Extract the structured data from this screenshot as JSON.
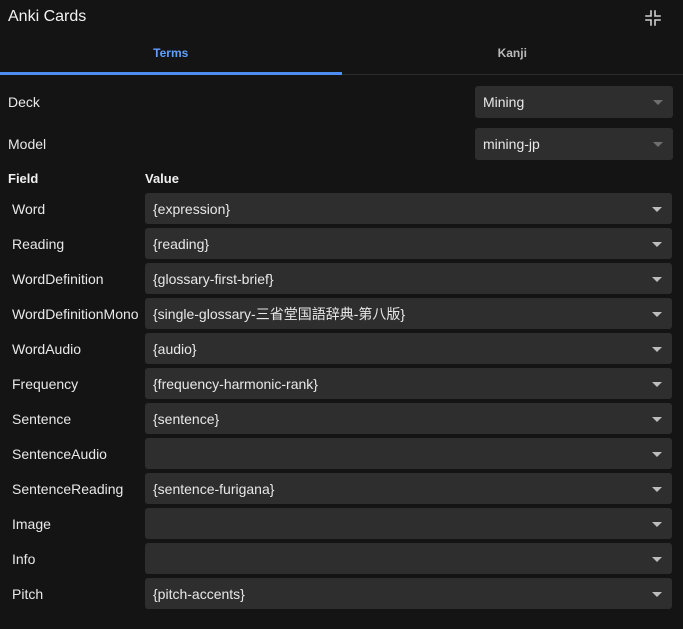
{
  "window": {
    "title": "Anki Cards",
    "collapse_icon": "collapse-arrows-icon"
  },
  "tabs": [
    {
      "label": "Terms",
      "active": true
    },
    {
      "label": "Kanji",
      "active": false
    }
  ],
  "deck": {
    "label": "Deck",
    "value": "Mining"
  },
  "model": {
    "label": "Model",
    "value": "mining-jp"
  },
  "fields_header": {
    "field": "Field",
    "value": "Value"
  },
  "fields": [
    {
      "name": "Word",
      "value": "{expression}"
    },
    {
      "name": "Reading",
      "value": "{reading}"
    },
    {
      "name": "WordDefinition",
      "value": "{glossary-first-brief}"
    },
    {
      "name": "WordDefinitionMono",
      "value": "{single-glossary-三省堂国語辞典-第八版}"
    },
    {
      "name": "WordAudio",
      "value": "{audio}"
    },
    {
      "name": "Frequency",
      "value": "{frequency-harmonic-rank}"
    },
    {
      "name": "Sentence",
      "value": "{sentence}"
    },
    {
      "name": "SentenceAudio",
      "value": ""
    },
    {
      "name": "SentenceReading",
      "value": "{sentence-furigana}"
    },
    {
      "name": "Image",
      "value": ""
    },
    {
      "name": "Info",
      "value": ""
    },
    {
      "name": "Pitch",
      "value": "{pitch-accents}"
    }
  ],
  "colors": {
    "background": "#141414",
    "control": "#2e2e2e",
    "accent": "#4e8ef0",
    "text": "#e8e8e8"
  }
}
